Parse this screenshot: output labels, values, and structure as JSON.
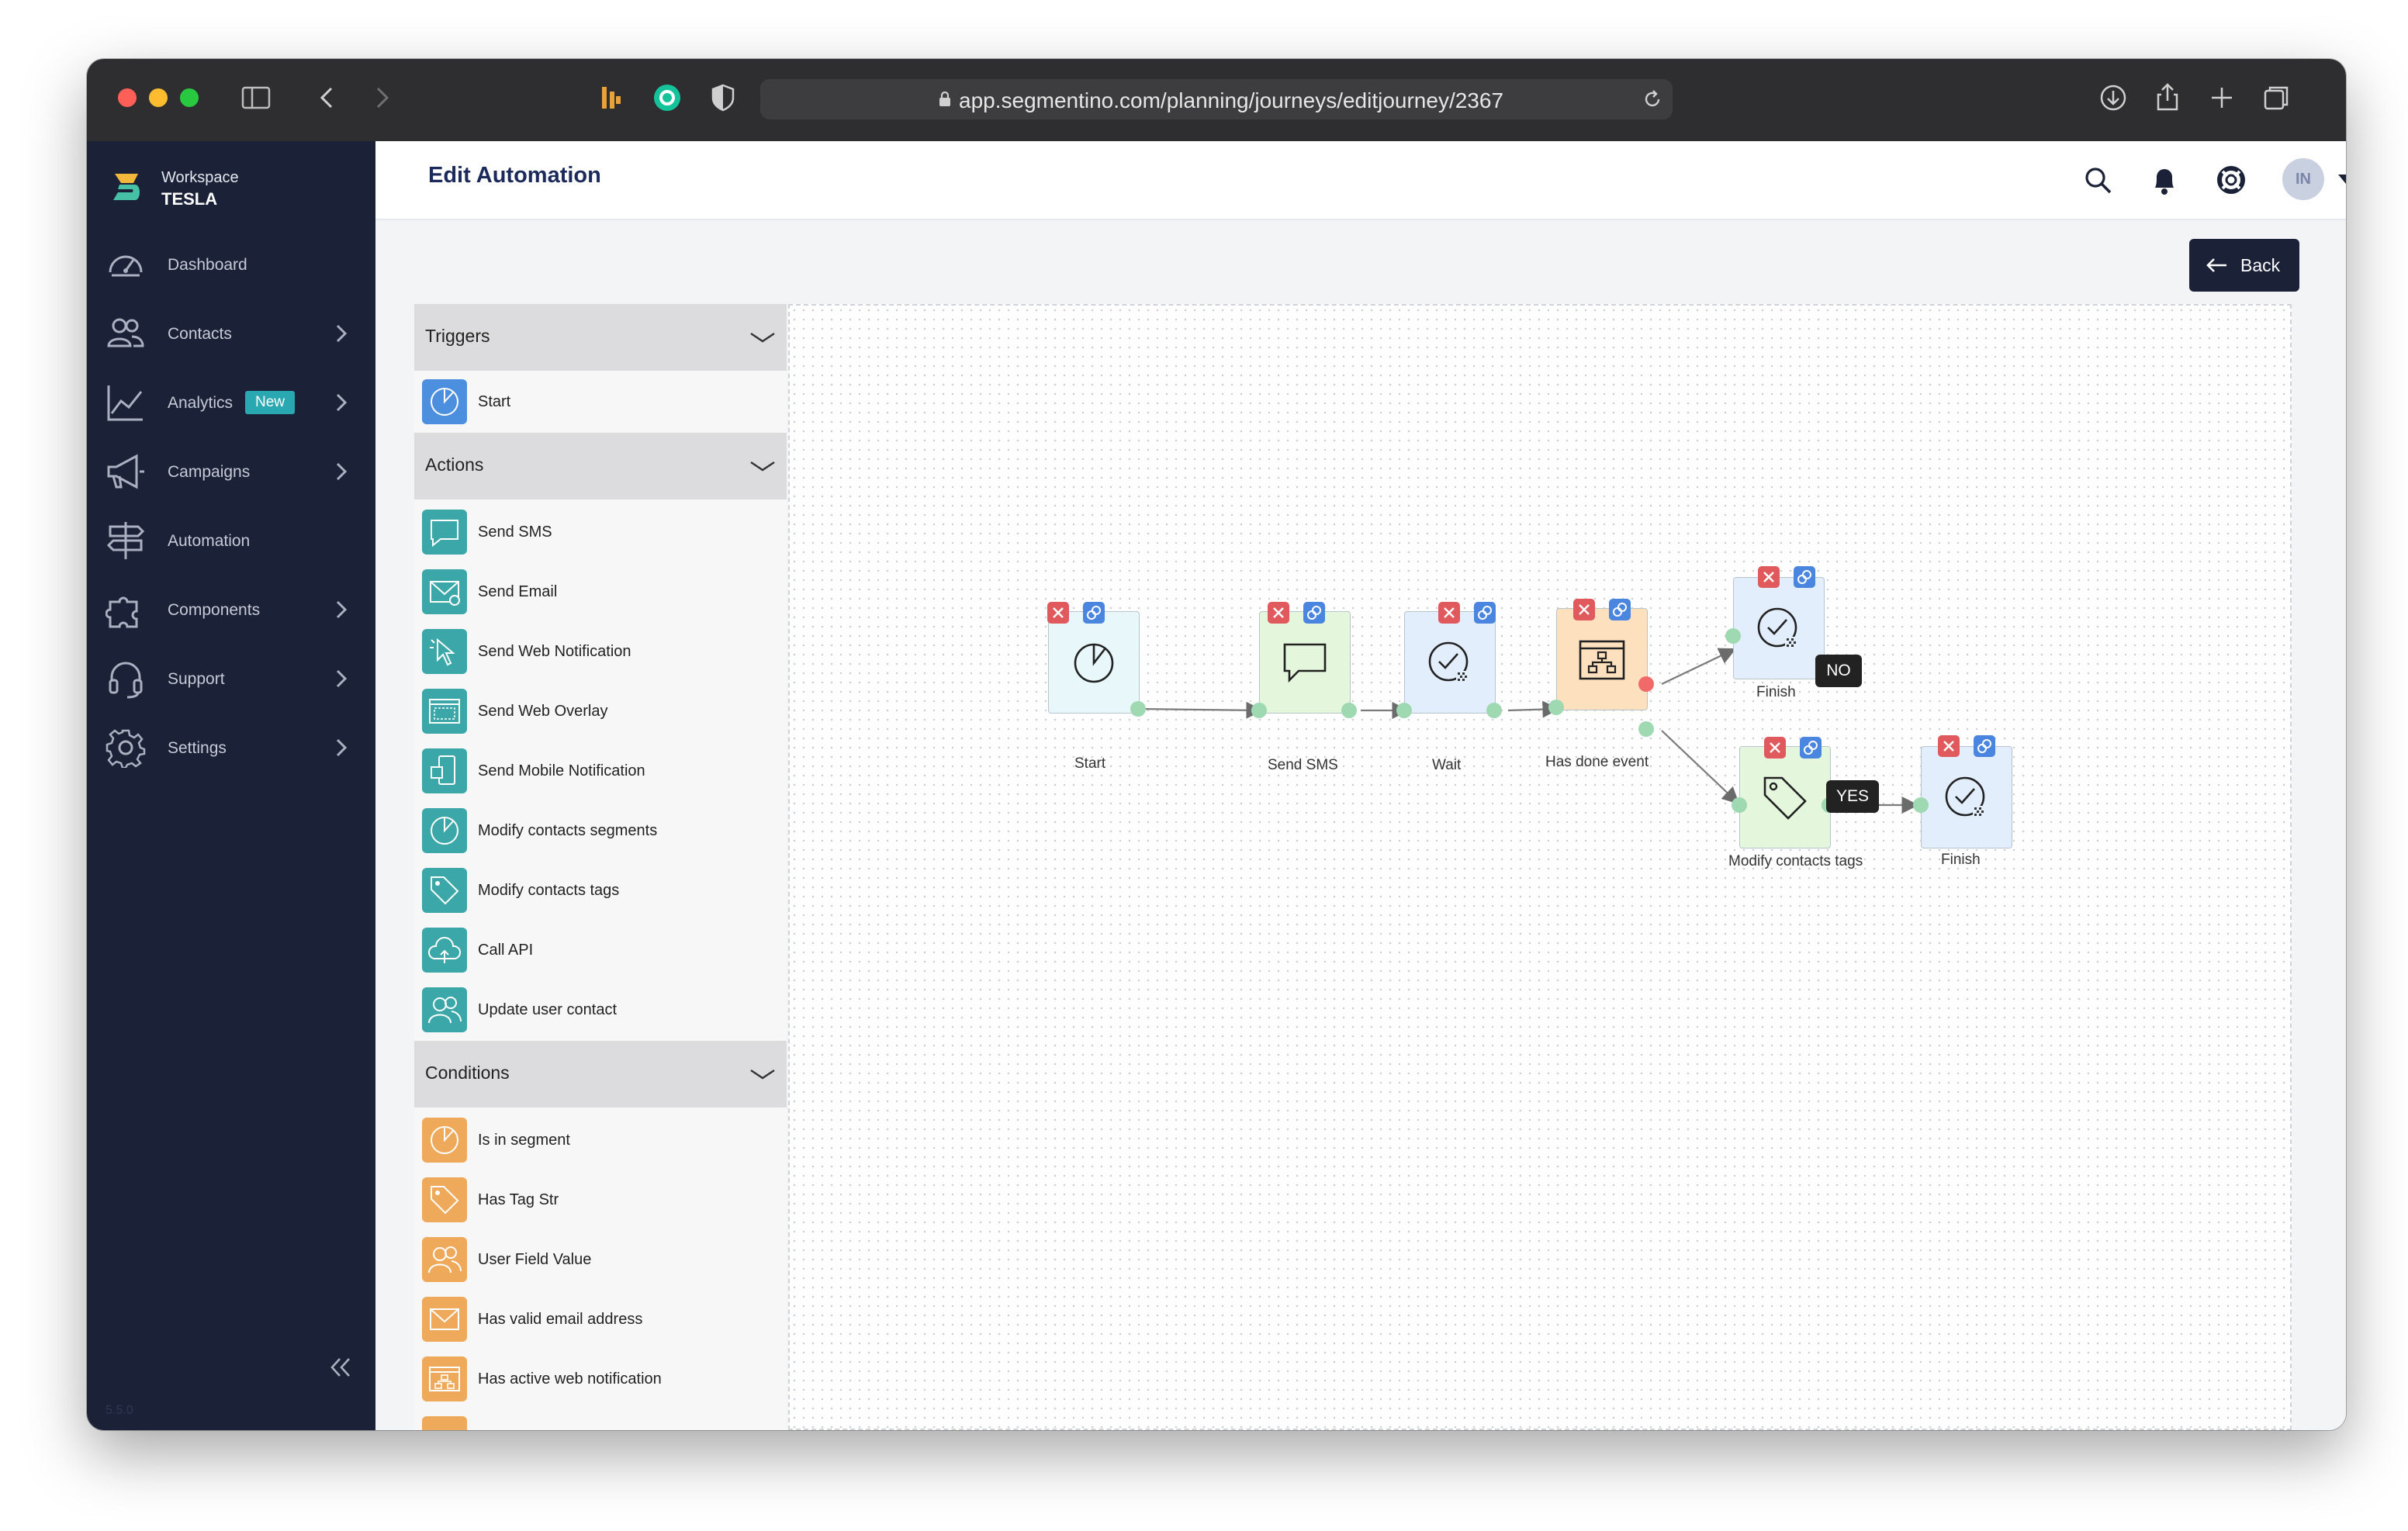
{
  "browser": {
    "url": "app.segmentino.com/planning/journeys/editjourney/2367"
  },
  "workspace": {
    "label": "Workspace",
    "name": "TESLA"
  },
  "sidebar": {
    "items": [
      {
        "label": "Dashboard",
        "icon": "dashboard-icon",
        "has_chevron": false
      },
      {
        "label": "Contacts",
        "icon": "contacts-icon",
        "has_chevron": true
      },
      {
        "label": "Analytics",
        "icon": "analytics-icon",
        "has_chevron": true,
        "badge": "New"
      },
      {
        "label": "Campaigns",
        "icon": "megaphone-icon",
        "has_chevron": true
      },
      {
        "label": "Automation",
        "icon": "signpost-icon",
        "has_chevron": false
      },
      {
        "label": "Components",
        "icon": "puzzle-icon",
        "has_chevron": true
      },
      {
        "label": "Support",
        "icon": "headset-icon",
        "has_chevron": true
      },
      {
        "label": "Settings",
        "icon": "gear-icon",
        "has_chevron": true
      }
    ],
    "version": "5.5.0"
  },
  "header": {
    "title": "Edit Automation",
    "avatar_initials": "IN"
  },
  "toolbar": {
    "back_label": "Back"
  },
  "panel": {
    "triggers": {
      "title": "Triggers",
      "items": [
        {
          "label": "Start",
          "icon": "pie-chart-icon"
        }
      ]
    },
    "actions": {
      "title": "Actions",
      "items": [
        {
          "label": "Send SMS",
          "icon": "chat-bubble-icon"
        },
        {
          "label": "Send Email",
          "icon": "envelope-icon"
        },
        {
          "label": "Send Web Notification",
          "icon": "cursor-click-icon"
        },
        {
          "label": "Send Web Overlay",
          "icon": "window-icon"
        },
        {
          "label": "Send Mobile Notification",
          "icon": "mobile-icon"
        },
        {
          "label": "Modify contacts segments",
          "icon": "pie-chart-icon"
        },
        {
          "label": "Modify contacts tags",
          "icon": "tag-icon"
        },
        {
          "label": "Call API",
          "icon": "cloud-icon"
        },
        {
          "label": "Update user contact",
          "icon": "users-icon"
        }
      ]
    },
    "conditions": {
      "title": "Conditions",
      "items": [
        {
          "label": "Is in segment",
          "icon": "pie-chart-icon"
        },
        {
          "label": "Has Tag Str",
          "icon": "tag-icon"
        },
        {
          "label": "User Field Value",
          "icon": "users-icon"
        },
        {
          "label": "Has valid email address",
          "icon": "envelope-icon"
        },
        {
          "label": "Has active web notification",
          "icon": "sitemap-icon"
        }
      ]
    }
  },
  "flow": {
    "nodes": [
      {
        "id": "start",
        "label": "Start",
        "icon": "pie-chart-icon"
      },
      {
        "id": "sms",
        "label": "Send SMS",
        "icon": "chat-bubble-icon"
      },
      {
        "id": "wait",
        "label": "Wait",
        "icon": "clock-icon"
      },
      {
        "id": "event",
        "label": "Has done event",
        "icon": "sitemap-icon"
      },
      {
        "id": "finish1",
        "label": "Finish",
        "icon": "clock-icon"
      },
      {
        "id": "tags",
        "label": "Modify contacts tags",
        "icon": "tag-icon"
      },
      {
        "id": "finish2",
        "label": "Finish",
        "icon": "clock-icon"
      }
    ],
    "branch_no": "NO",
    "branch_yes": "YES"
  },
  "colors": {
    "sidebar_bg": "#1b2238",
    "action_teal": "#3ba7a8",
    "condition_orange": "#efa95a",
    "trigger_blue": "#4c8fdf",
    "delete_red": "#e0595c",
    "edit_blue": "#4a86df"
  }
}
